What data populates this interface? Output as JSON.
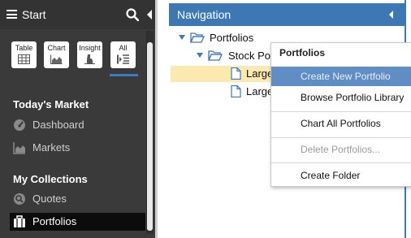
{
  "sidebar": {
    "title": "Start",
    "view_buttons": [
      {
        "label": "Table",
        "icon": "table-icon"
      },
      {
        "label": "Chart",
        "icon": "chart-icon"
      },
      {
        "label": "Insight",
        "icon": "insight-icon"
      },
      {
        "label": "All",
        "icon": "list-icon"
      }
    ],
    "selected_view": "All",
    "sections": [
      {
        "heading": "Today's Market",
        "items": [
          {
            "label": "Dashboard",
            "icon": "dashboard-icon"
          },
          {
            "label": "Markets",
            "icon": "markets-icon"
          }
        ]
      },
      {
        "heading": "My Collections",
        "items": [
          {
            "label": "Quotes",
            "icon": "quotes-icon"
          },
          {
            "label": "Portfolios",
            "icon": "portfolios-icon"
          }
        ]
      }
    ],
    "active_item": "Portfolios"
  },
  "navigation": {
    "title": "Navigation",
    "tree": [
      {
        "label": "Portfolios",
        "type": "folder-open",
        "level": 0
      },
      {
        "label": "Stock Por",
        "type": "folder-open",
        "level": 1
      },
      {
        "label": "Large",
        "type": "document",
        "level": 2,
        "selected": true
      },
      {
        "label": "Large",
        "type": "document",
        "level": 2
      }
    ]
  },
  "context_menu": {
    "title": "Portfolios",
    "items": [
      {
        "label": "Create New Portfolio",
        "state": "hover"
      },
      {
        "label": "Browse Portfolio Library",
        "state": "normal"
      },
      {
        "label": "Chart All Portfolios",
        "state": "normal"
      },
      {
        "label": "Delete Portfolios...",
        "state": "disabled"
      },
      {
        "label": "Create Folder",
        "state": "normal"
      }
    ]
  },
  "colors": {
    "nav_header": "#3d78b5",
    "sidebar_bg": "#3a3a3a",
    "menu_hover": "#5f8dc4",
    "selected_row": "#fbeab0"
  }
}
